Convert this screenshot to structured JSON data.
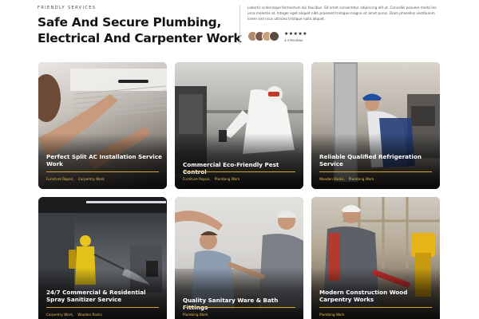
{
  "header": {
    "eyebrow": "FRIENDLY SERVICES",
    "headline_line1": "Safe And Secure Plumbing,",
    "headline_line2": "Electrical And Carpenter  Work",
    "intro": "Lobortis scelerisque fermentum dui faucibus. Sit amet consectetur adipiscing elit ut. Convallis posuere morbi leo urna molestie at. Integer eget aliquet nibh praesent tristique magna sit amet purus. Diam phasellus vestibulum lorem sed risus ultricies tristique nulla aliquet."
  },
  "rating": {
    "stars": "★★★★★",
    "reviews": "4.4 Reviews",
    "avatar_colors": [
      "#b08a6a",
      "#7d5a45",
      "#c9a27e",
      "#5a4a40"
    ]
  },
  "accent_color": "#d7a52a",
  "cards": [
    {
      "title": "Perfect Split AC Installation Service Work",
      "tags": [
        "Furniture Repair,",
        "Carpentry Work"
      ]
    },
    {
      "title": "Commercial Eco-Friendly Pest Control",
      "tags": [
        "Furniture Repair,",
        "Plumbing Work"
      ]
    },
    {
      "title": "Reliable Qualified Refrigeration Service",
      "tags": [
        "Wooden Racks,",
        "Plumbing Work"
      ]
    },
    {
      "title": "24/7 Commercial & Residential Spray Sanitizer Service",
      "tags": [
        "Carpentry Work,",
        "Wooden Racks"
      ]
    },
    {
      "title": "Quality Sanitary Ware & Bath Fittings",
      "tags": [
        "Plumbing Work"
      ]
    },
    {
      "title": "Modern Construction Wood Carpentry Works",
      "tags": [
        "Plumbing Work"
      ]
    }
  ]
}
